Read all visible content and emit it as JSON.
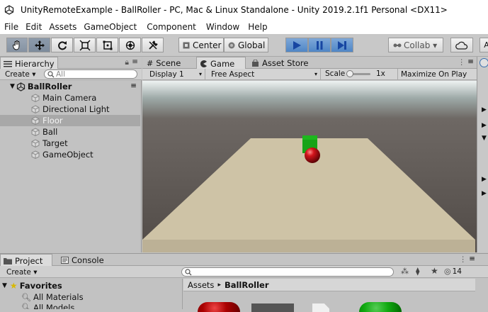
{
  "window": {
    "title": "UnityRemoteExample - BallRoller - PC, Mac & Linux Standalone - Unity 2019.2.1f1 Personal <DX11>"
  },
  "menu": {
    "items": [
      "File",
      "Edit",
      "Assets",
      "GameObject",
      "Component",
      "Window",
      "Help"
    ]
  },
  "toolbar": {
    "pivot_label": "Center",
    "space_label": "Global",
    "collab_label": "Collab ▾"
  },
  "hierarchy": {
    "tab_label": "Hierarchy",
    "create_label": "Create ▾",
    "search_placeholder": "All",
    "scene_name": "BallRoller",
    "items": [
      "Main Camera",
      "Directional Light",
      "Floor",
      "Ball",
      "Target",
      "GameObject"
    ],
    "selected_item": "Floor"
  },
  "center_tabs": {
    "scene": "Scene",
    "game": "Game",
    "asset_store": "Asset Store"
  },
  "game_view": {
    "display": "Display 1",
    "aspect": "Free Aspect",
    "scale_label": "Scale",
    "scale_value": "1x",
    "maximize_label": "Maximize On Play"
  },
  "project": {
    "tab_label": "Project",
    "console_label": "Console",
    "create_label": "Create ▾",
    "favorites_label": "Favorites",
    "favorites": [
      "All Materials",
      "All Models"
    ],
    "breadcrumb_root": "Assets",
    "breadcrumb_sep": "▸",
    "breadcrumb_current": "BallRoller",
    "hidden_count": "14"
  },
  "colors": {
    "accent_play": "#3d7fcf",
    "selection": "#a8a8a8",
    "ball": "#c0141b",
    "target": "#1db11d",
    "floor": "#cfc3a6"
  }
}
